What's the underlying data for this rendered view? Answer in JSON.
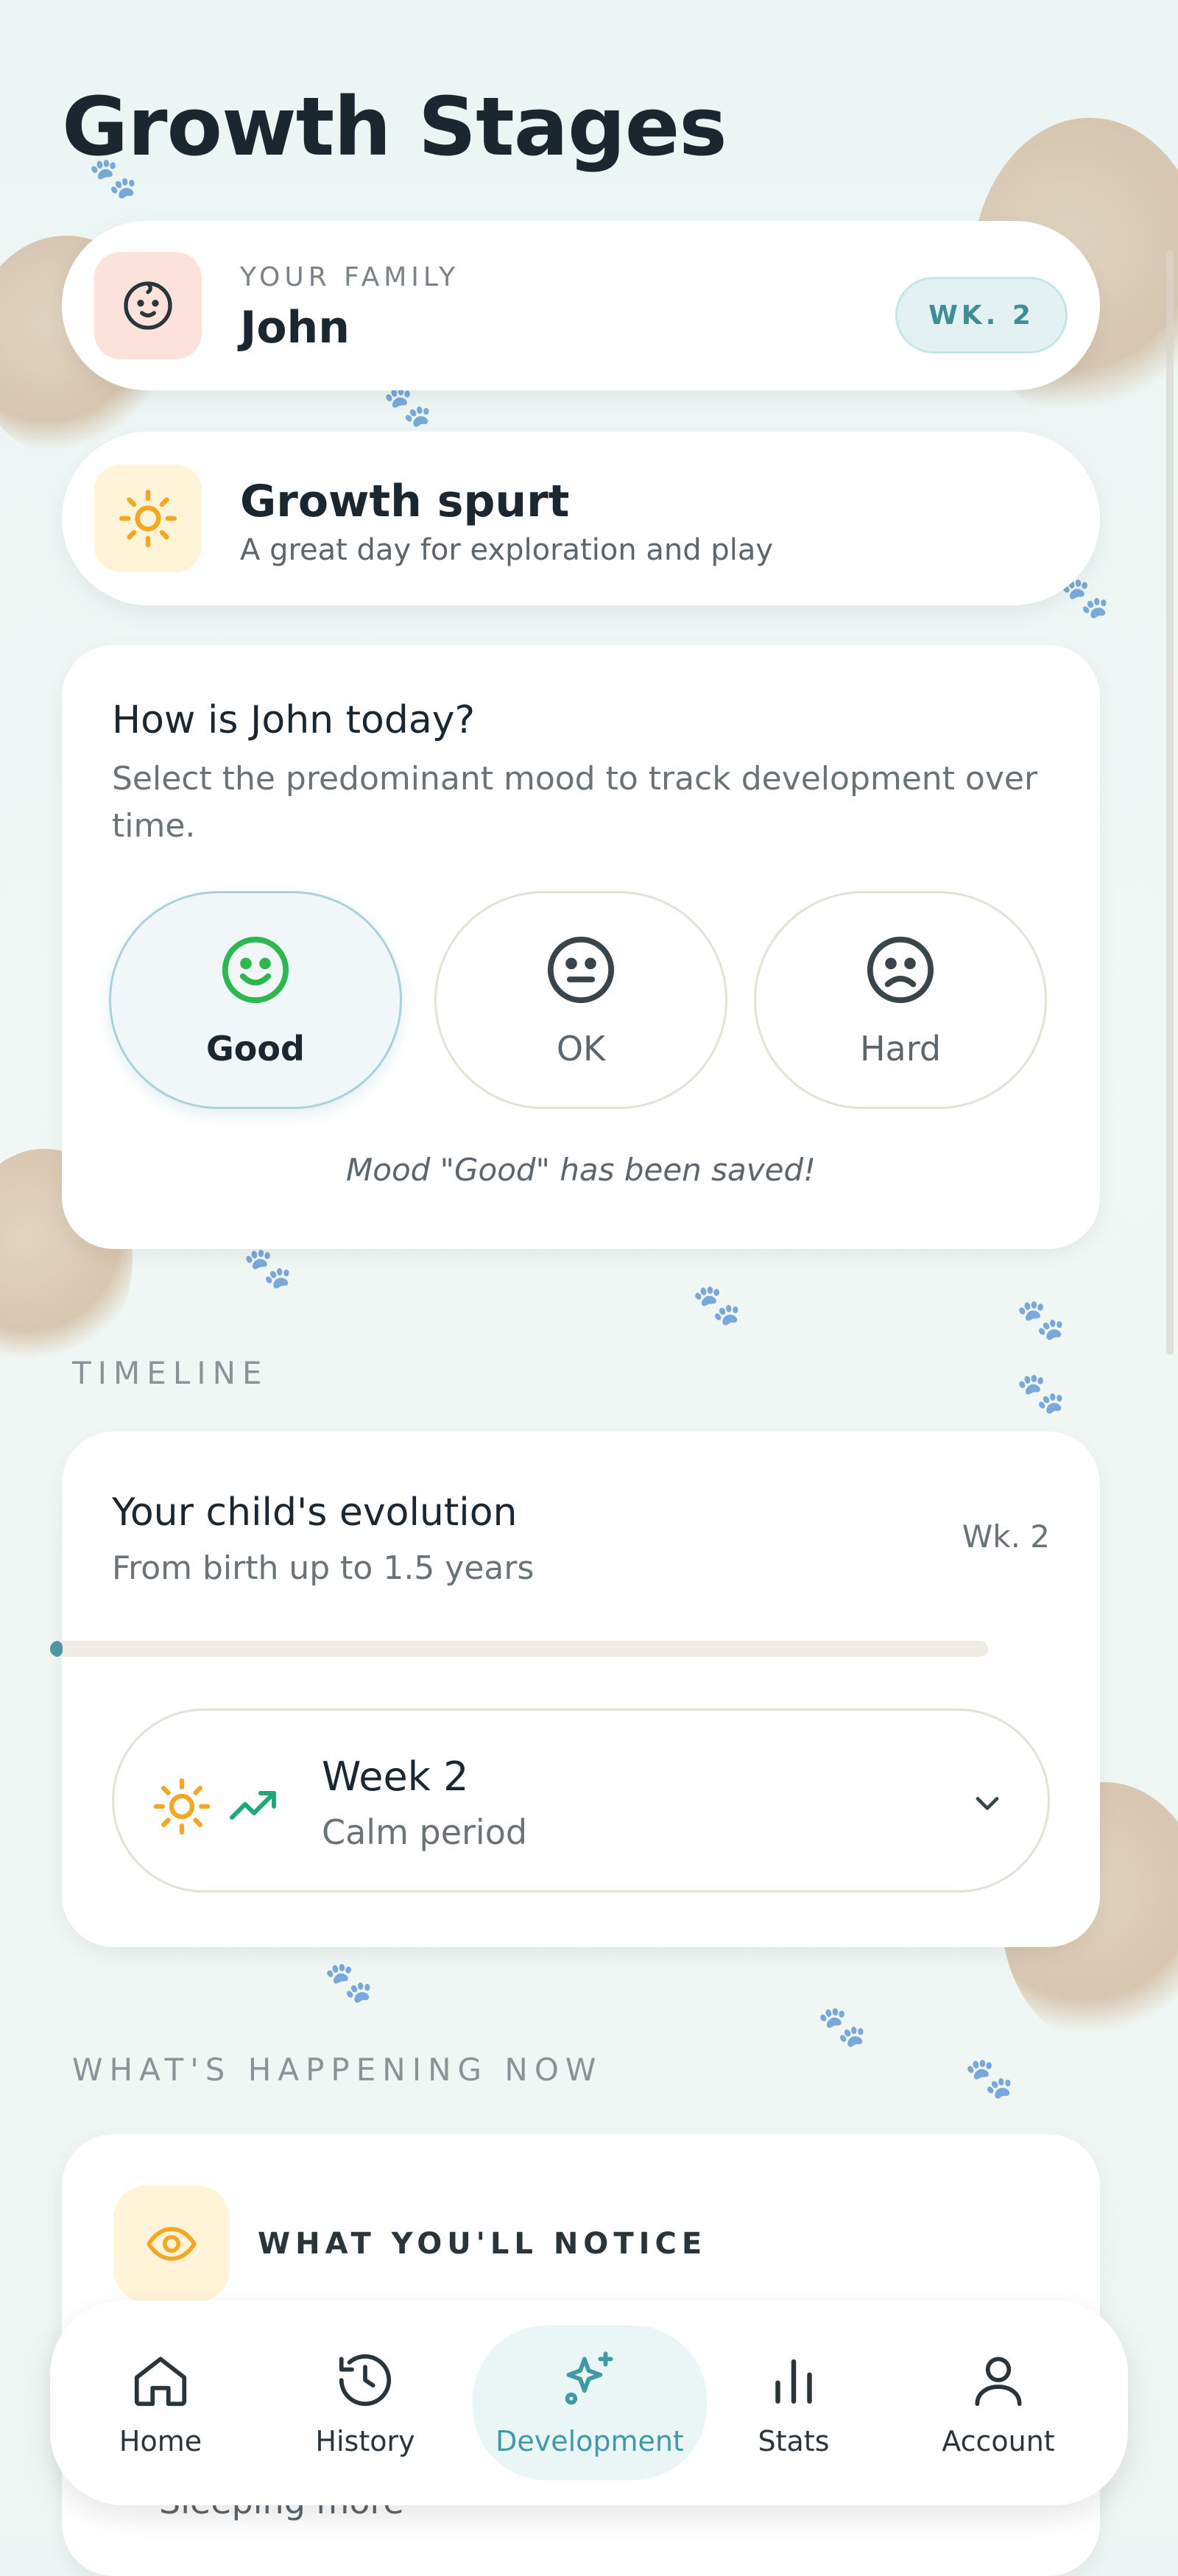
{
  "page": {
    "title": "Growth Stages"
  },
  "family": {
    "label": "YOUR FAMILY",
    "name": "John",
    "badge": "WK. 2",
    "icon": "baby-face-icon"
  },
  "status": {
    "title": "Growth spurt",
    "subtitle": "A great day for exploration and play",
    "icon": "sun-icon"
  },
  "mood": {
    "question": "How is John today?",
    "description": "Select the predominant mood to track development over time.",
    "options": [
      {
        "label": "Good",
        "icon": "smile-face-icon",
        "selected": true
      },
      {
        "label": "OK",
        "icon": "neutral-face-icon",
        "selected": false
      },
      {
        "label": "Hard",
        "icon": "sad-face-icon",
        "selected": false
      }
    ],
    "saved_message": "Mood \"Good\" has been saved!"
  },
  "timeline": {
    "section_label": "TIMELINE",
    "title": "Your child's evolution",
    "subtitle": "From birth up to 1.5 years",
    "week_label": "Wk. 2",
    "progress_fraction": 0.013,
    "week": {
      "title": "Week 2",
      "subtitle": "Calm period",
      "icons": [
        "sun-icon",
        "trend-up-icon",
        "chevron-down-icon"
      ]
    }
  },
  "happening": {
    "section_label": "WHAT'S HAPPENING NOW",
    "notice_label": "WHAT YOU'LL NOTICE",
    "notice_icon": "eye-icon",
    "first_item": "Sleeping more"
  },
  "nav": {
    "items": [
      {
        "label": "Home",
        "icon": "home-icon",
        "active": false
      },
      {
        "label": "History",
        "icon": "history-icon",
        "active": false
      },
      {
        "label": "Development",
        "icon": "sparkles-icon",
        "active": true
      },
      {
        "label": "Stats",
        "icon": "bar-chart-icon",
        "active": false
      },
      {
        "label": "Account",
        "icon": "user-icon",
        "active": false
      }
    ]
  },
  "colors": {
    "accent": "#3f9aa6",
    "good": "#2db84f",
    "sun": "#f5a623",
    "trend": "#1fa67a"
  }
}
